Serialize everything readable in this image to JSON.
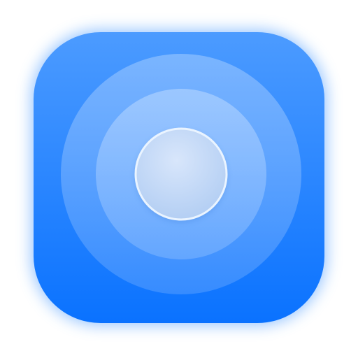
{
  "icon": {
    "name": "concentric-rings-app-icon",
    "colors": {
      "glow": "#4f9dff",
      "tile_top": "#4c9bff",
      "tile_bottom": "#0a72ff",
      "outer_ring": "#8cbcff",
      "middle_ring": "#a9cbff",
      "center_disc": "#c8dcf6",
      "center_rim": "#eaf4ff"
    }
  }
}
